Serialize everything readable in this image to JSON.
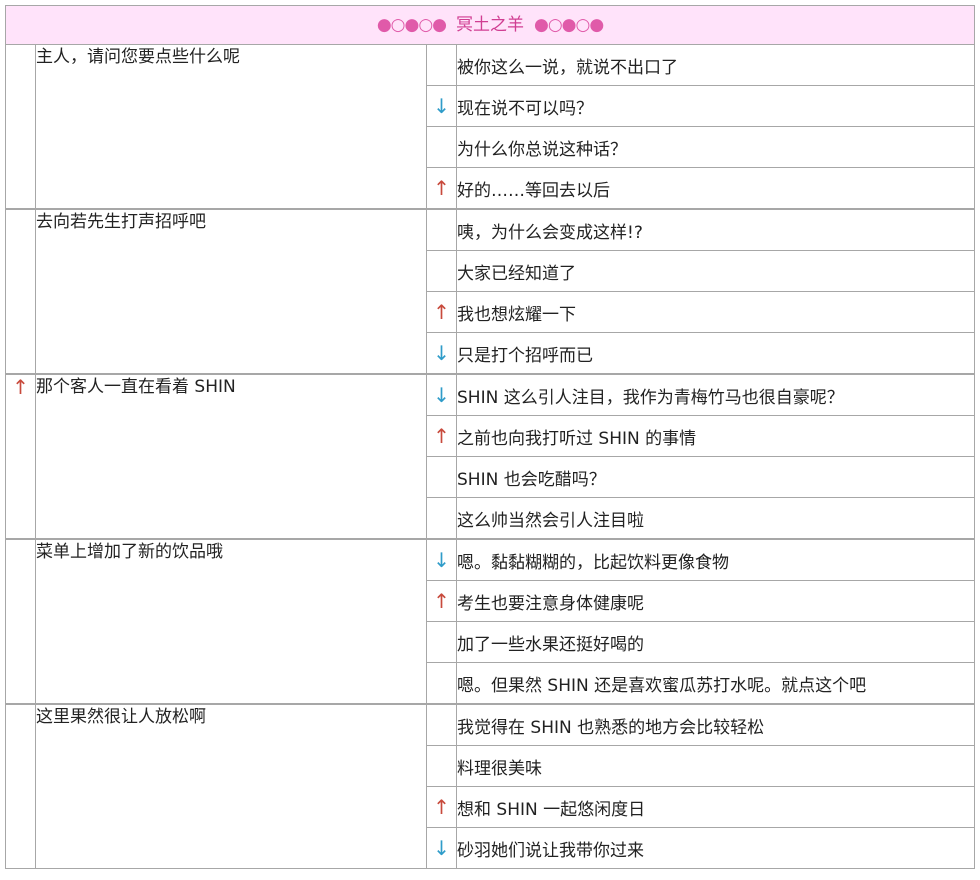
{
  "header": {
    "deco_left": "●○●○●",
    "title": "冥土之羊",
    "deco_right": "●○●○●"
  },
  "arrows": {
    "up": "↑",
    "down": "↓"
  },
  "colors": {
    "up": "#c84a3c",
    "down": "#2f9cc9",
    "header_bg": "#ffe3fa"
  },
  "groups": [
    {
      "marker": "",
      "prompt": "主人，请问您要点些什么呢",
      "replies": [
        {
          "marker": "",
          "text": "被你这么一说，就说不出口了"
        },
        {
          "marker": "down",
          "text": "现在说不可以吗？"
        },
        {
          "marker": "",
          "text": "为什么你总说这种话？"
        },
        {
          "marker": "up",
          "text": "好的……等回去以后"
        }
      ]
    },
    {
      "marker": "",
      "prompt": "去向若先生打声招呼吧",
      "replies": [
        {
          "marker": "",
          "text": "咦，为什么会变成这样!?"
        },
        {
          "marker": "",
          "text": "大家已经知道了"
        },
        {
          "marker": "up",
          "text": "我也想炫耀一下"
        },
        {
          "marker": "down",
          "text": "只是打个招呼而已"
        }
      ]
    },
    {
      "marker": "up",
      "prompt": "那个客人一直在看着 SHIN",
      "replies": [
        {
          "marker": "down",
          "text": "SHIN 这么引人注目，我作为青梅竹马也很自豪呢？"
        },
        {
          "marker": "up",
          "text": "之前也向我打听过 SHIN 的事情"
        },
        {
          "marker": "",
          "text": "SHIN 也会吃醋吗？"
        },
        {
          "marker": "",
          "text": "这么帅当然会引人注目啦"
        }
      ]
    },
    {
      "marker": "",
      "prompt": "菜单上增加了新的饮品哦",
      "replies": [
        {
          "marker": "down",
          "text": "嗯。黏黏糊糊的，比起饮料更像食物"
        },
        {
          "marker": "up",
          "text": "考生也要注意身体健康呢"
        },
        {
          "marker": "",
          "text": "加了一些水果还挺好喝的"
        },
        {
          "marker": "",
          "text": "嗯。但果然 SHIN 还是喜欢蜜瓜苏打水呢。就点这个吧"
        }
      ]
    },
    {
      "marker": "",
      "prompt": "这里果然很让人放松啊",
      "replies": [
        {
          "marker": "",
          "text": "我觉得在 SHIN 也熟悉的地方会比较轻松"
        },
        {
          "marker": "",
          "text": "料理很美味"
        },
        {
          "marker": "up",
          "text": "想和 SHIN 一起悠闲度日"
        },
        {
          "marker": "down",
          "text": "砂羽她们说让我带你过来"
        }
      ]
    }
  ]
}
